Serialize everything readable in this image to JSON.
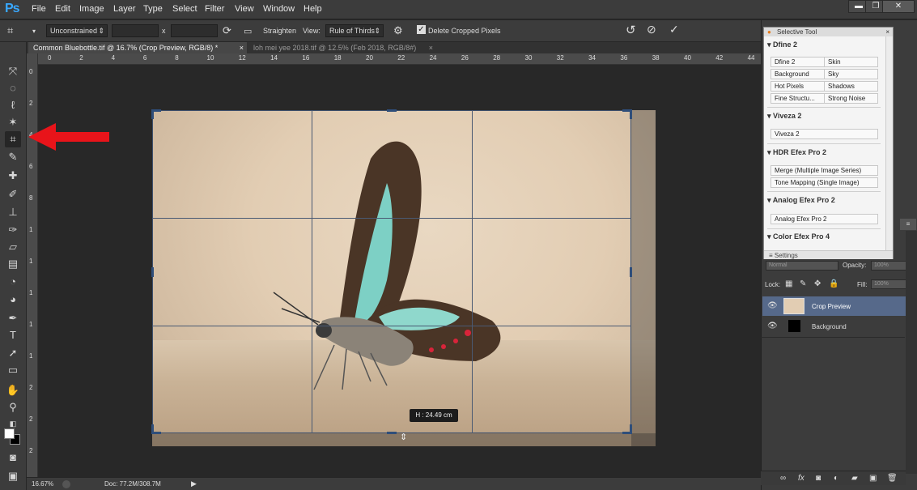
{
  "app": {
    "logo": "Ps"
  },
  "menu": [
    "File",
    "Edit",
    "Image",
    "Layer",
    "Type",
    "Select",
    "Filter",
    "View",
    "Window",
    "Help"
  ],
  "window_controls": {
    "minimize": "▬",
    "restore": "❐",
    "close": "✕"
  },
  "options_bar": {
    "ratio": "Unconstrained",
    "ratio_arrow": "⇕",
    "width_value": "",
    "height_value": "",
    "separator": "x",
    "straighten_label": "Straighten",
    "view_label": "View:",
    "view_value": "Rule of Thirds",
    "delete_cropped_label": "Delete Cropped Pixels",
    "delete_cropped_checked": true
  },
  "tabs": [
    {
      "label": "Common Bluebottle.tif @ 16.7% (Crop Preview, RGB/8) *",
      "close": "×"
    },
    {
      "label": "loh mei yee 2018.tif @ 12.5% (Feb 2018, RGB/8#)",
      "close": "×"
    }
  ],
  "ruler_h": [
    "0",
    "2",
    "4",
    "6",
    "8",
    "10",
    "12",
    "14",
    "16",
    "18",
    "20",
    "22",
    "24",
    "26",
    "28",
    "30",
    "32",
    "34",
    "36",
    "38",
    "40",
    "42",
    "44"
  ],
  "ruler_v": [
    "0",
    "2",
    "4",
    "6",
    "8",
    "1",
    "1",
    "1",
    "1",
    "1",
    "2",
    "2",
    "2"
  ],
  "crop_hint": "H :   24.49 cm",
  "status": {
    "zoom": "16.67%",
    "doc": "Doc: 77.2M/308.7M"
  },
  "selective_tool": {
    "title": "Selective Tool",
    "close": "×",
    "sections": [
      {
        "name": "Dfine 2",
        "items": [
          "Dfine 2",
          "Skin",
          "Background",
          "Sky",
          "Hot Pixels",
          "Shadows",
          "Fine Structu...",
          "Strong Noise"
        ]
      },
      {
        "name": "Viveza 2",
        "items": [
          "Viveza 2"
        ]
      },
      {
        "name": "HDR Efex Pro 2",
        "items": [
          "Merge (Multiple Image Series)",
          "Tone Mapping (Single Image)"
        ]
      },
      {
        "name": "Analog Efex Pro 2",
        "items": [
          "Analog Efex Pro 2"
        ]
      },
      {
        "name": "Color Efex Pro 4",
        "items": []
      }
    ],
    "settings_label": "Settings"
  },
  "layers": {
    "blend_mode": "Normal",
    "opacity_label": "Opacity:",
    "opacity_value": "100%",
    "lock_label": "Lock:",
    "fill_label": "Fill:",
    "fill_value": "100%",
    "items": [
      {
        "name": "Crop Preview",
        "selected": true
      },
      {
        "name": "Background",
        "selected": false
      }
    ]
  },
  "colors": {
    "accent": "#39a8ff",
    "arrow": "#e8141a",
    "selection": "#56698a"
  }
}
